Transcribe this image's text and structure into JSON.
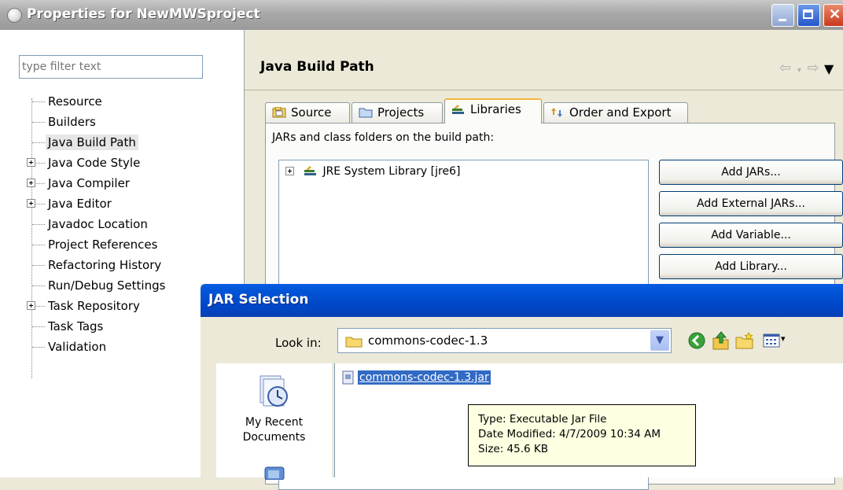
{
  "window": {
    "title": "Properties for NewMWSproject"
  },
  "sidebar": {
    "filter_placeholder": "type filter text",
    "items": [
      {
        "label": "Resource"
      },
      {
        "label": "Builders"
      },
      {
        "label": "Java Build Path"
      },
      {
        "label": "Java Code Style"
      },
      {
        "label": "Java Compiler"
      },
      {
        "label": "Java Editor"
      },
      {
        "label": "Javadoc Location"
      },
      {
        "label": "Project References"
      },
      {
        "label": "Refactoring History"
      },
      {
        "label": "Run/Debug Settings"
      },
      {
        "label": "Task Repository"
      },
      {
        "label": "Task Tags"
      },
      {
        "label": "Validation"
      }
    ]
  },
  "main": {
    "title": "Java Build Path",
    "tabs": [
      {
        "label": "Source"
      },
      {
        "label": "Projects"
      },
      {
        "label": "Libraries"
      },
      {
        "label": "Order and Export"
      }
    ],
    "jars_label": "JARs and class folders on the build path:",
    "libraries": [
      {
        "label": "JRE System Library [jre6]"
      }
    ],
    "buttons": {
      "add_jars": "Add JARs...",
      "add_external_jars": "Add External JARs...",
      "add_variable": "Add Variable...",
      "add_library": "Add Library..."
    }
  },
  "dialog": {
    "title": "JAR Selection",
    "look_in_label": "Look in:",
    "look_in_value": "commons-codec-1.3",
    "places": [
      {
        "label": "My Recent Documents"
      }
    ],
    "files": [
      {
        "name": "commons-codec-1.3.jar"
      }
    ],
    "tooltip": {
      "type": "Type: Executable Jar File",
      "modified": "Date Modified: 4/7/2009 10:34 AM",
      "size": "Size: 45.6 KB"
    }
  }
}
